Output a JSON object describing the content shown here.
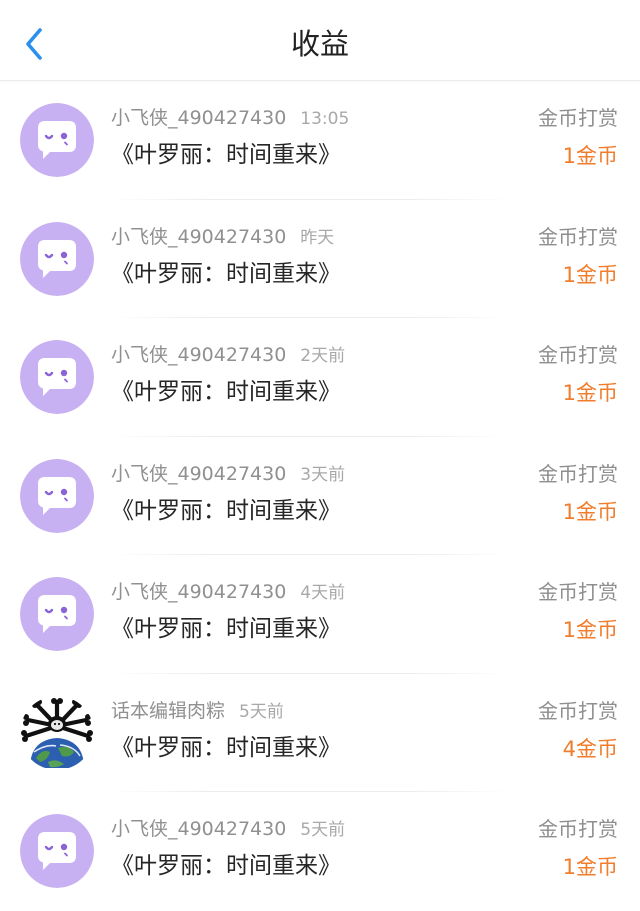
{
  "header": {
    "title": "收益",
    "back_icon": "chevron-left-icon",
    "accent_color": "#2b8ff0"
  },
  "colors": {
    "avatar_bg": "#c8b1f2",
    "avatar_accent": "#8a64d6",
    "amount": "#f07c2c"
  },
  "records": [
    {
      "user": "小飞侠_490427430",
      "time": "13:05",
      "work": "《叶罗丽：时间重来》",
      "type": "金币打赏",
      "amount": "1金币",
      "avatar": "default-chat-avatar-icon"
    },
    {
      "user": "小飞侠_490427430",
      "time": "昨天",
      "work": "《叶罗丽：时间重来》",
      "type": "金币打赏",
      "amount": "1金币",
      "avatar": "default-chat-avatar-icon"
    },
    {
      "user": "小飞侠_490427430",
      "time": "2天前",
      "work": "《叶罗丽：时间重来》",
      "type": "金币打赏",
      "amount": "1金币",
      "avatar": "default-chat-avatar-icon"
    },
    {
      "user": "小飞侠_490427430",
      "time": "3天前",
      "work": "《叶罗丽：时间重来》",
      "type": "金币打赏",
      "amount": "1金币",
      "avatar": "default-chat-avatar-icon"
    },
    {
      "user": "小飞侠_490427430",
      "time": "4天前",
      "work": "《叶罗丽：时间重来》",
      "type": "金币打赏",
      "amount": "1金币",
      "avatar": "default-chat-avatar-icon"
    },
    {
      "user": "话本编辑肉粽",
      "time": "5天前",
      "work": "《叶罗丽：时间重来》",
      "type": "金币打赏",
      "amount": "4金币",
      "avatar": "earth-cartoon-avatar-icon"
    },
    {
      "user": "小飞侠_490427430",
      "time": "5天前",
      "work": "《叶罗丽：时间重来》",
      "type": "金币打赏",
      "amount": "1金币",
      "avatar": "default-chat-avatar-icon"
    }
  ]
}
